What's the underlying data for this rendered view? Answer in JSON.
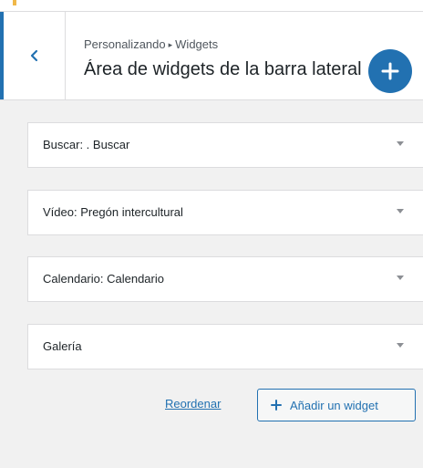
{
  "header": {
    "breadcrumb_parent": "Personalizando",
    "breadcrumb_separator": "▸",
    "breadcrumb_current": "Widgets",
    "title": "Área de widgets de la barra lateral"
  },
  "widgets": [
    {
      "label": "Buscar: . Buscar"
    },
    {
      "label": "Vídeo: Pregón intercultural"
    },
    {
      "label": "Calendario: Calendario"
    },
    {
      "label": "Galería"
    }
  ],
  "actions": {
    "reorder_label": "Reordenar",
    "add_widget_label": "Añadir un widget"
  },
  "icons": {
    "back": "chevron-left-icon",
    "fab": "plus-icon",
    "add_widget": "plus-icon",
    "widget_toggle": "triangle-down-icon"
  },
  "colors": {
    "accent": "#2271b1",
    "background": "#f1f1f1",
    "panel": "#ffffff",
    "border": "#dcdcde",
    "top_mark": "#f0b849"
  }
}
